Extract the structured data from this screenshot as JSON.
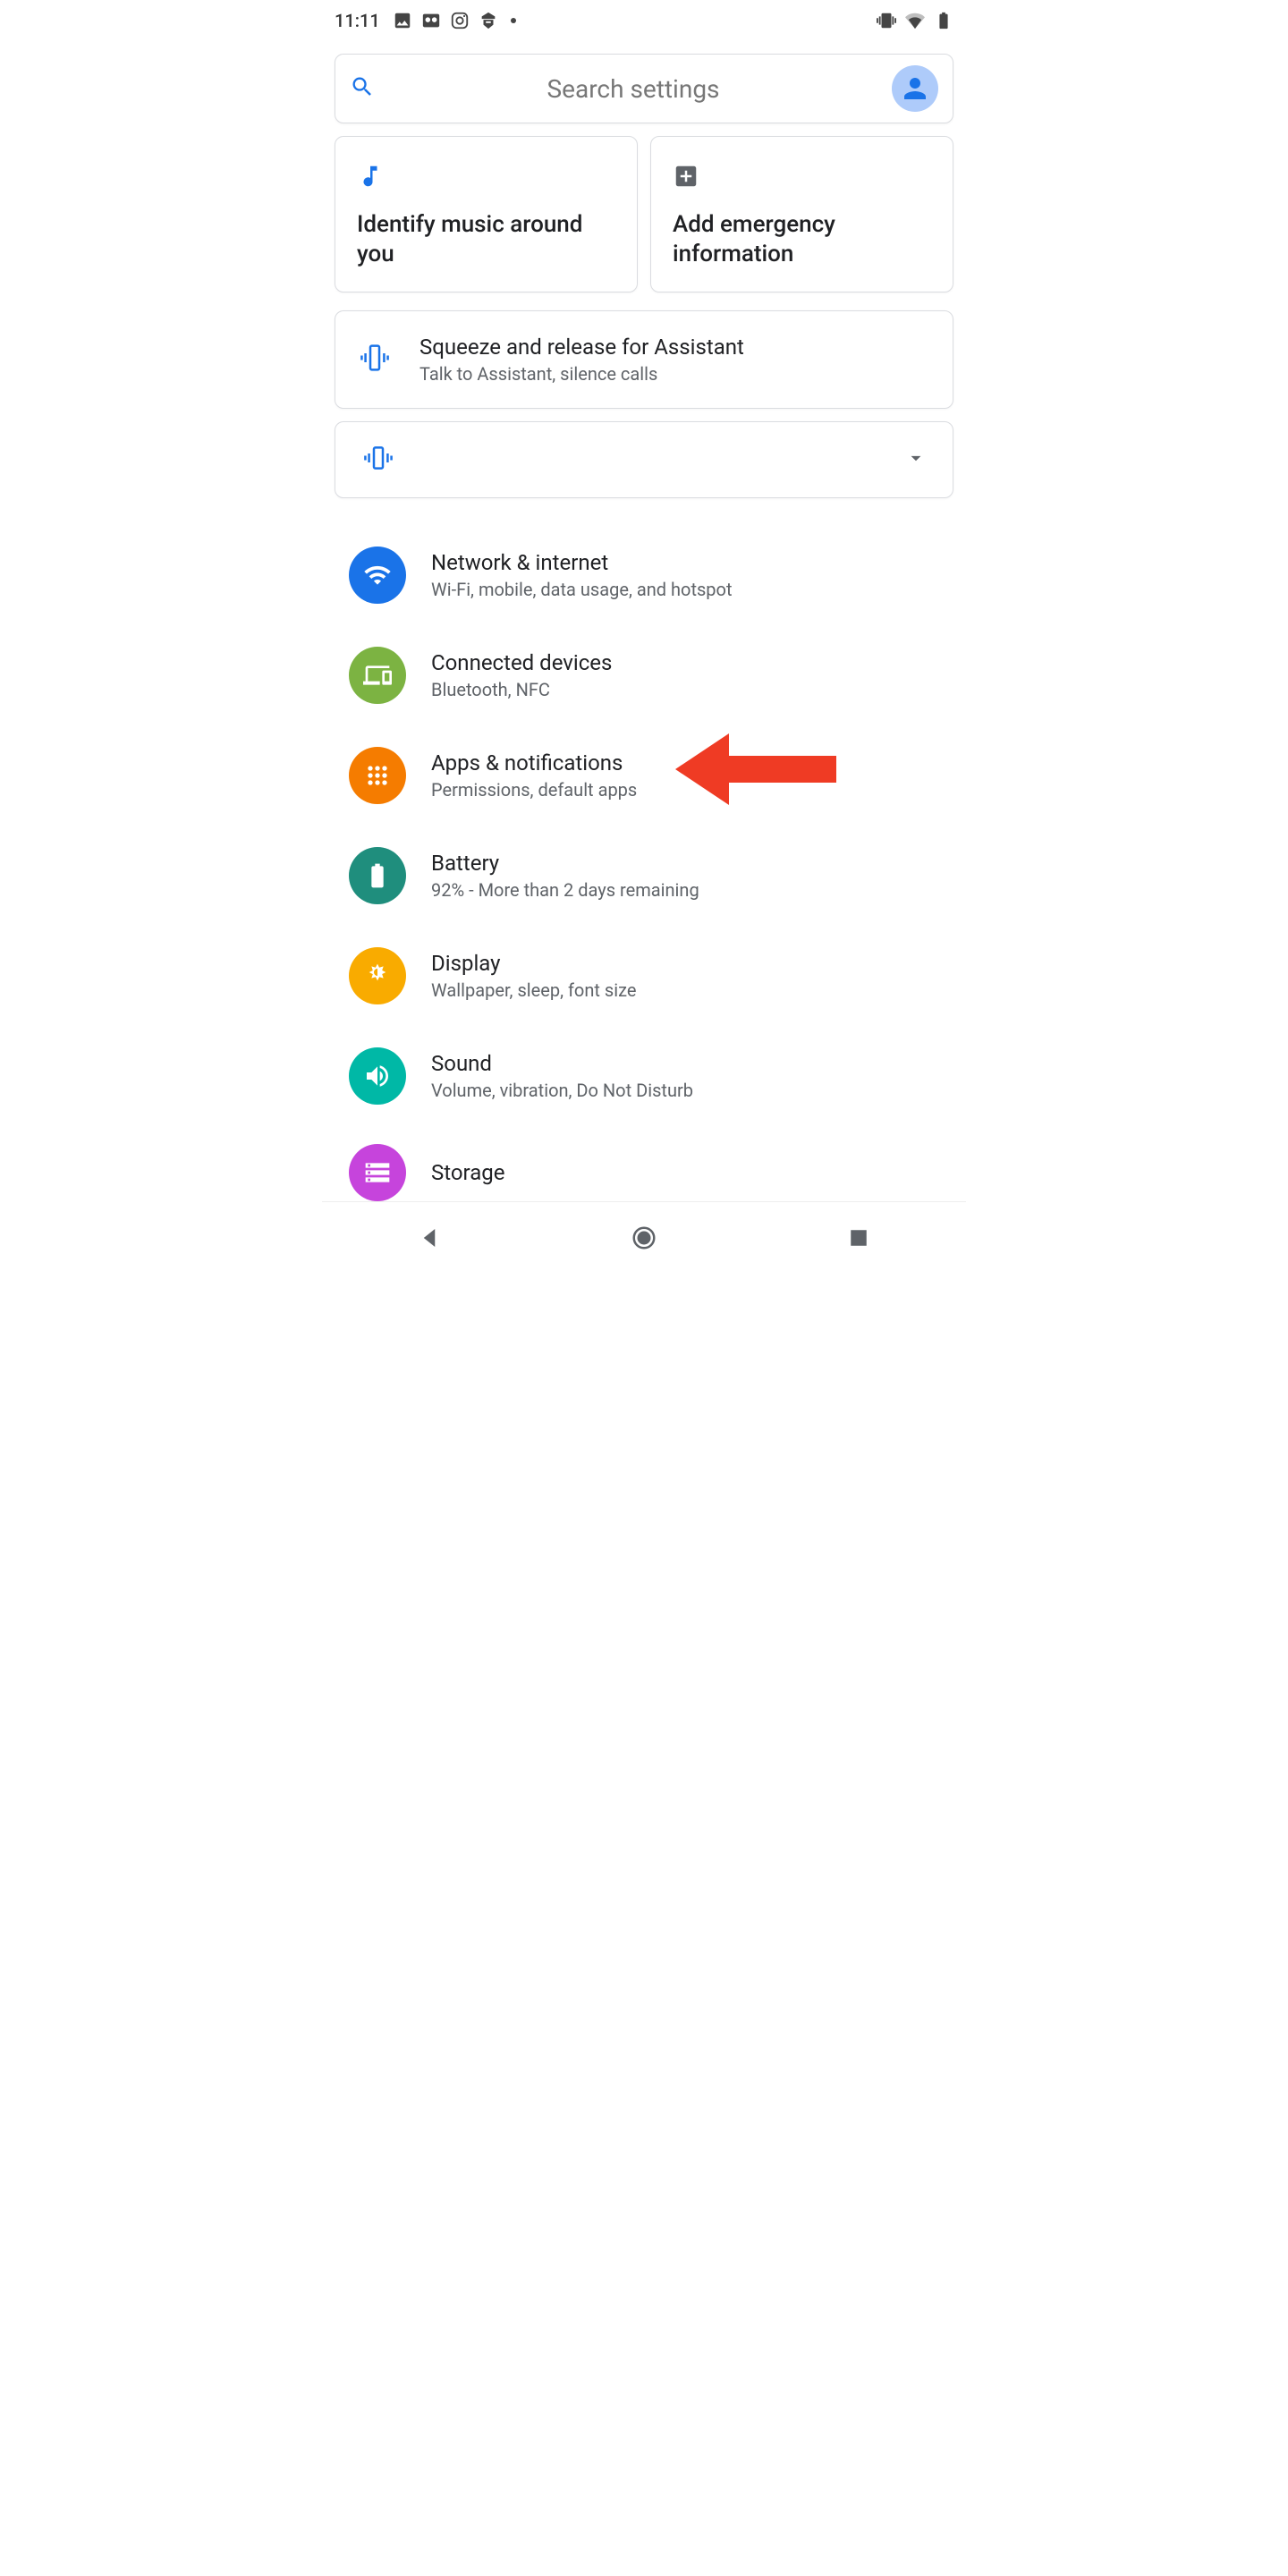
{
  "status_bar": {
    "time": "11:11"
  },
  "search": {
    "placeholder": "Search settings"
  },
  "cards": {
    "music": {
      "text": "Identify music around you"
    },
    "emergency": {
      "text": "Add emergency information"
    }
  },
  "assistant_card": {
    "title": "Squeeze and release for Assistant",
    "subtitle": "Talk to Assistant, silence calls"
  },
  "settings": [
    {
      "id": "network",
      "title": "Network & internet",
      "subtitle": "Wi-Fi, mobile, data usage, and hotspot",
      "color": "#1a73e8"
    },
    {
      "id": "devices",
      "title": "Connected devices",
      "subtitle": "Bluetooth, NFC",
      "color": "#7cb342"
    },
    {
      "id": "apps",
      "title": "Apps & notifications",
      "subtitle": "Permissions, default apps",
      "color": "#f57c00"
    },
    {
      "id": "battery",
      "title": "Battery",
      "subtitle": "92% - More than 2 days remaining",
      "color": "#1f8e7d"
    },
    {
      "id": "display",
      "title": "Display",
      "subtitle": "Wallpaper, sleep, font size",
      "color": "#f9ab00"
    },
    {
      "id": "sound",
      "title": "Sound",
      "subtitle": "Volume, vibration, Do Not Disturb",
      "color": "#00b8a6"
    },
    {
      "id": "storage",
      "title": "Storage",
      "subtitle": "",
      "color": "#c644dc"
    }
  ]
}
